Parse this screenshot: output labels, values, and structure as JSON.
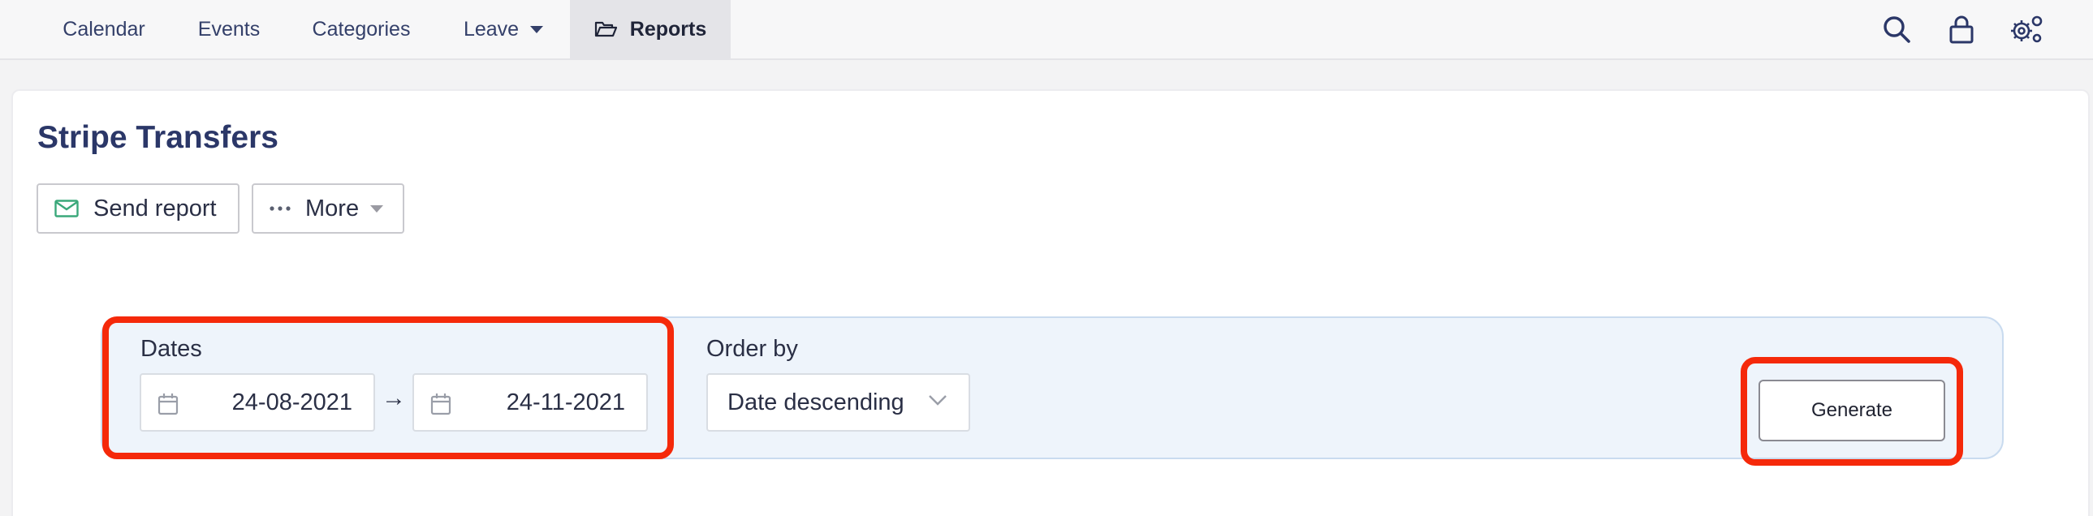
{
  "nav": {
    "items": [
      {
        "label": "Calendar"
      },
      {
        "label": "Events"
      },
      {
        "label": "Categories"
      },
      {
        "label": "Leave"
      },
      {
        "label": "Reports"
      }
    ],
    "right_icons": [
      "search-icon",
      "lock-icon",
      "gears-icon"
    ]
  },
  "page": {
    "title": "Stripe Transfers"
  },
  "toolbar": {
    "send_report_label": "Send report",
    "more_label": "More"
  },
  "filters": {
    "dates_label": "Dates",
    "date_from": "24-08-2021",
    "date_to": "24-11-2021",
    "arrow": "→",
    "order_by_label": "Order by",
    "order_by_value": "Date descending",
    "generate_label": "Generate"
  },
  "colors": {
    "accent": "#2b3768",
    "highlight": "#f5290a",
    "panel_bg": "#eef4fb",
    "mail_icon": "#3aa87a"
  }
}
